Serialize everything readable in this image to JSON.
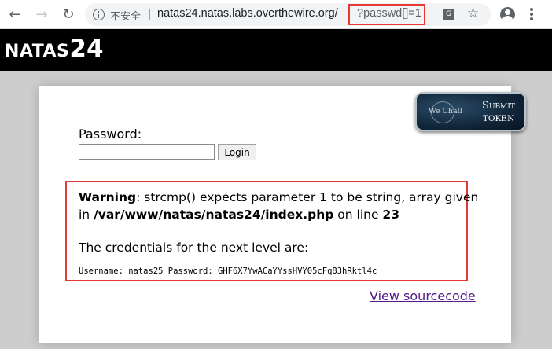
{
  "browser": {
    "insecure_label": "不安全",
    "url_host": "natas24.natas.labs.overthewire.org/",
    "url_path": "?passwd[]=1",
    "icons": {
      "back": "back-arrow-icon",
      "forward": "forward-arrow-icon",
      "reload": "reload-icon",
      "info": "info-icon",
      "translate": "translate-icon",
      "bookmark": "star-icon",
      "account": "account-icon",
      "menu": "kebab-menu-icon"
    }
  },
  "header": {
    "title_prefix": "NATAS",
    "title_number": "24"
  },
  "token_button": {
    "logo_text": "We Chall",
    "label_line1": "Submit",
    "label_line2": "token"
  },
  "form": {
    "password_label": "Password:",
    "password_value": "",
    "login_label": "Login"
  },
  "result": {
    "warning_word": "Warning",
    "warning_msg": ": strcmp() expects parameter 1 to be string, array given",
    "in_word": "in ",
    "file_path": "/var/www/natas/natas24/index.php",
    "on_line": " on line ",
    "line_number": "23",
    "credentials_text": "The credentials for the next level are:",
    "credentials_code": "Username: natas25 Password: GHF6X7YwACaYYssHVY05cFq83hRktl4c"
  },
  "footer": {
    "source_link": "View sourcecode"
  },
  "colors": {
    "highlight_red": "#e53935",
    "link_purple": "#551a8b",
    "header_black": "#000000",
    "page_gray": "#cdcdcd"
  }
}
